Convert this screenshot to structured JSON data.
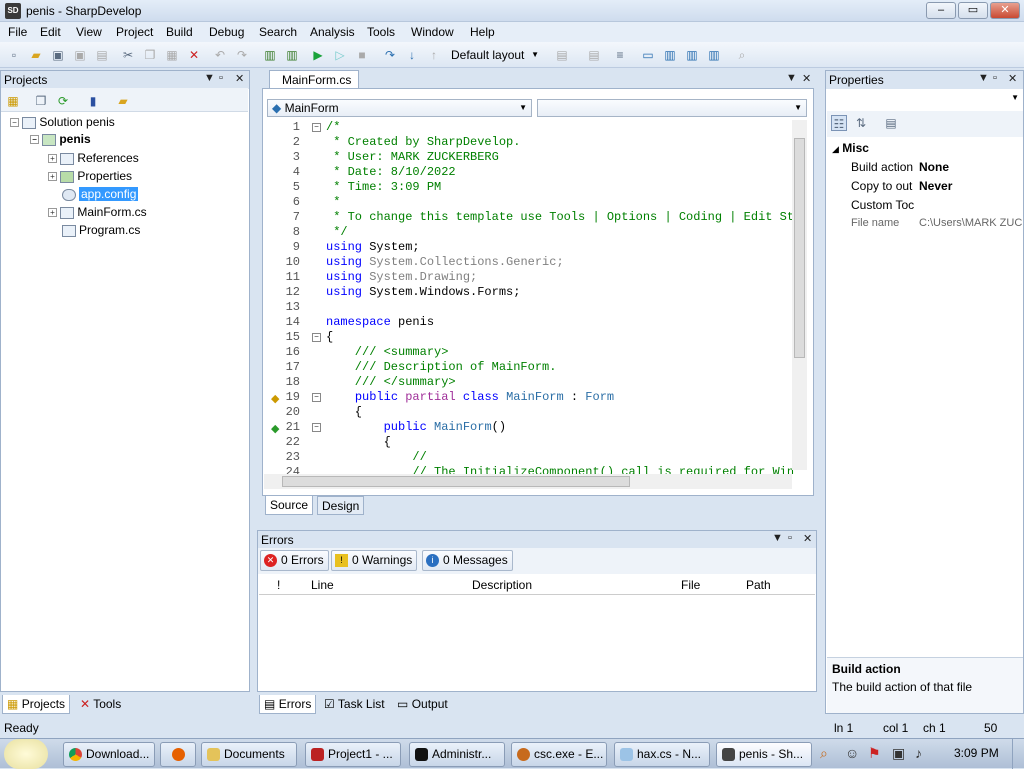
{
  "window": {
    "title": "penis - SharpDevelop",
    "icon": "SD",
    "min": "–",
    "max": "▭",
    "close": "✕"
  },
  "menu": [
    "File",
    "Edit",
    "View",
    "Project",
    "Build",
    "Debug",
    "Search",
    "Analysis",
    "Tools",
    "Window",
    "Help"
  ],
  "toolbar": {
    "layout": "Default layout"
  },
  "projects": {
    "title": "Projects",
    "tree": {
      "solution": "Solution penis",
      "project": "penis",
      "references": "References",
      "properties": "Properties",
      "appconfig": "app.config",
      "mainform": "MainForm.cs",
      "program": "Program.cs"
    },
    "tabs": {
      "projects": "Projects",
      "tools": "Tools"
    }
  },
  "editor": {
    "tab": "MainForm.cs",
    "class_dropdown": "MainForm",
    "member_dropdown": "",
    "lines": [
      {
        "n": "1",
        "t": "/*",
        "c": "cm"
      },
      {
        "n": "2",
        "t": " * Created by SharpDevelop.",
        "c": "cm"
      },
      {
        "n": "3",
        "t": " * User: MARK ZUCKERBERG",
        "c": "cm"
      },
      {
        "n": "4",
        "t": " * Date: 8/10/2022",
        "c": "cm"
      },
      {
        "n": "5",
        "t": " * Time: 3:09 PM",
        "c": "cm"
      },
      {
        "n": "6",
        "t": " *",
        "c": "cm"
      },
      {
        "n": "7",
        "t": " * To change this template use Tools | Options | Coding | Edit Sta",
        "c": "cm"
      },
      {
        "n": "8",
        "t": " */",
        "c": "cm"
      },
      {
        "n": "9",
        "kw": "using",
        "t": " System;",
        "c": ""
      },
      {
        "n": "10",
        "kw": "using",
        "t": " System.Collections.Generic;",
        "c": "gr"
      },
      {
        "n": "11",
        "kw": "using",
        "t": " System.Drawing;",
        "c": "gr"
      },
      {
        "n": "12",
        "kw": "using",
        "t": " System.Windows.Forms;",
        "c": ""
      },
      {
        "n": "13",
        "t": "",
        "c": ""
      },
      {
        "n": "14",
        "kw": "namespace",
        "t": " penis",
        "c": ""
      },
      {
        "n": "15",
        "t": "{",
        "c": ""
      },
      {
        "n": "16",
        "t": "    /// <summary>",
        "c": "cm"
      },
      {
        "n": "17",
        "t": "    /// Description of MainForm.",
        "c": "cm"
      },
      {
        "n": "18",
        "t": "    /// </summary>",
        "c": "cm"
      },
      {
        "n": "19",
        "t": "    public partial class MainForm : Form",
        "c": "decl"
      },
      {
        "n": "20",
        "t": "    {",
        "c": ""
      },
      {
        "n": "21",
        "t": "        public MainForm()",
        "c": "ctor"
      },
      {
        "n": "22",
        "t": "        {",
        "c": ""
      },
      {
        "n": "23",
        "t": "            //",
        "c": "cm"
      },
      {
        "n": "24",
        "t": "            // The InitializeComponent() call is required for Wind",
        "c": "cm"
      }
    ],
    "view_tabs": {
      "source": "Source",
      "design": "Design"
    }
  },
  "errors": {
    "title": "Errors",
    "errors_btn": "0 Errors",
    "warnings_btn": "0 Warnings",
    "messages_btn": "0 Messages",
    "columns": {
      "bang": "!",
      "line": "Line",
      "desc": "Description",
      "file": "File",
      "path": "Path"
    },
    "tabs": {
      "errors": "Errors",
      "tasklist": "Task List",
      "output": "Output"
    }
  },
  "properties": {
    "title": "Properties",
    "category": "Misc",
    "rows": [
      {
        "name": "Build action",
        "value": "None"
      },
      {
        "name": "Copy to out",
        "value": "Never"
      },
      {
        "name": "Custom Toc",
        "value": ""
      },
      {
        "name": "File name",
        "value": "C:\\Users\\MARK ZUC"
      }
    ],
    "desc_title": "Build action",
    "desc_text": "The build action of that file"
  },
  "status": {
    "text": "Ready",
    "ln": "ln 1",
    "col": "col 1",
    "ch": "ch 1",
    "ovr": "50"
  },
  "taskbar": {
    "items": [
      "Download...",
      "",
      "Documents",
      "Project1 - ...",
      "Administr...",
      "csc.exe - E...",
      "hax.cs - N...",
      "penis - Sh..."
    ],
    "clock": "3:09 PM"
  }
}
